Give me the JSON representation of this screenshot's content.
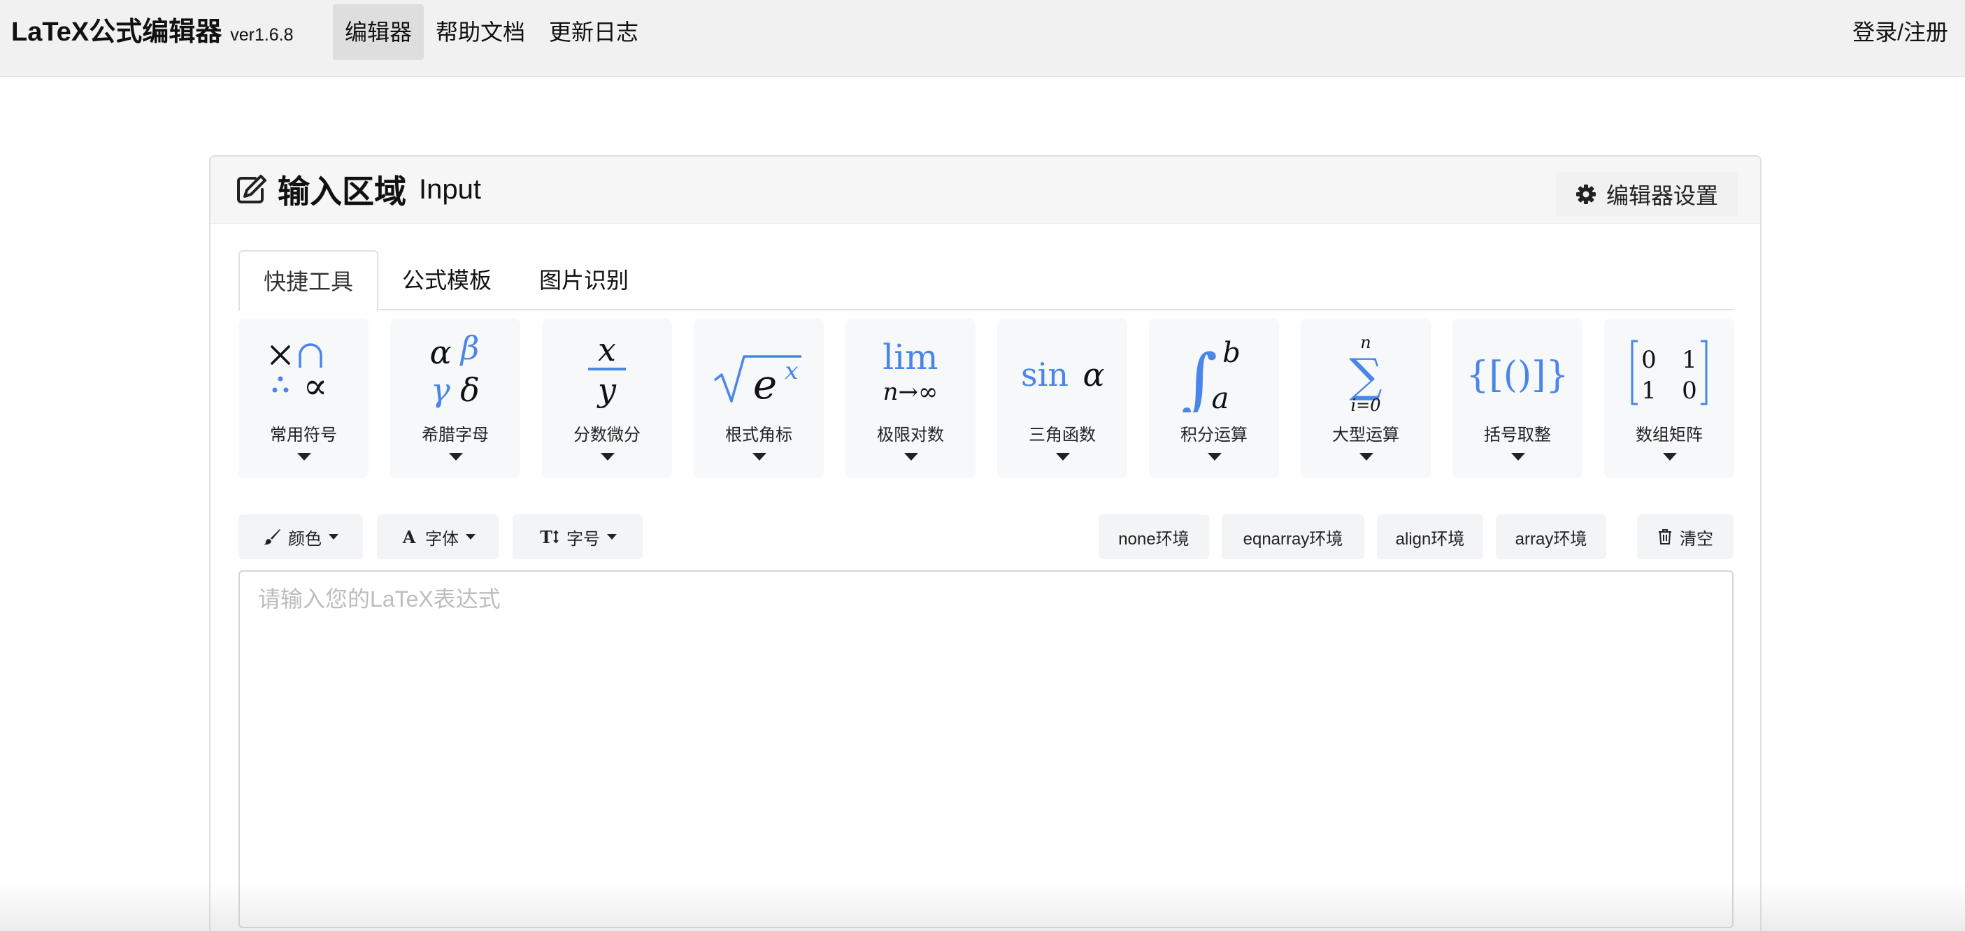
{
  "navbar": {
    "brand": "LaTeX公式编辑器",
    "version": "ver1.6.8",
    "links": [
      "编辑器",
      "帮助文档",
      "更新日志"
    ],
    "login": "登录/注册"
  },
  "card": {
    "title_cn": "输入区域",
    "title_en": "Input",
    "settings_label": "编辑器设置"
  },
  "tabs": [
    "快捷工具",
    "公式模板",
    "图片识别"
  ],
  "tools": [
    {
      "label": "常用符号",
      "icon": "symbols-icon"
    },
    {
      "label": "希腊字母",
      "icon": "greek-letters-icon"
    },
    {
      "label": "分数微分",
      "icon": "fraction-icon"
    },
    {
      "label": "根式角标",
      "icon": "radical-icon"
    },
    {
      "label": "极限对数",
      "icon": "limit-icon"
    },
    {
      "label": "三角函数",
      "icon": "trig-icon"
    },
    {
      "label": "积分运算",
      "icon": "integral-icon"
    },
    {
      "label": "大型运算",
      "icon": "summation-icon"
    },
    {
      "label": "括号取整",
      "icon": "brackets-icon"
    },
    {
      "label": "数组矩阵",
      "icon": "matrix-icon"
    }
  ],
  "toolbar": {
    "color": "颜色",
    "font": "字体",
    "size": "字号",
    "env_none": "none环境",
    "env_eqnarray": "eqnarray环境",
    "env_align": "align环境",
    "env_array": "array环境",
    "clear": "清空"
  },
  "editor": {
    "placeholder": "请输入您的LaTeX表达式",
    "value": ""
  },
  "colors": {
    "accent_blue": "#4a86e8",
    "navbar_bg": "#f1f1f1",
    "tool_bg": "#f7f8fa"
  }
}
